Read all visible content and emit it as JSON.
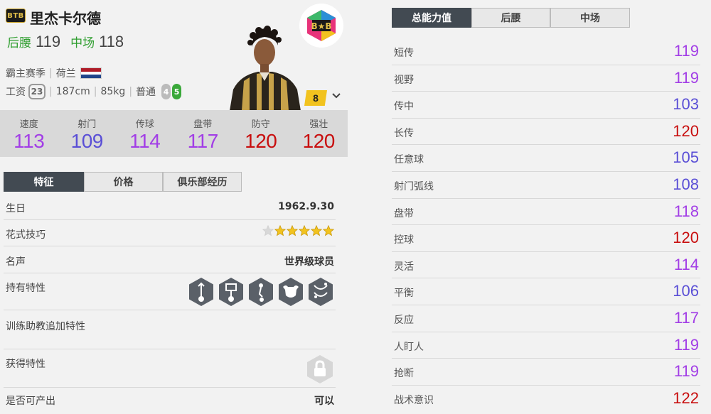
{
  "colors": {
    "purple": "#a23ee6",
    "indigo": "#5a4fd6",
    "red": "#c80e0e",
    "green": "#2f9e2f",
    "tab_active": "#424a52"
  },
  "header": {
    "season_badge": "BTB",
    "name": "里杰卡尔德",
    "positions": [
      {
        "label": "后腰",
        "value": "119"
      },
      {
        "label": "中场",
        "value": "118"
      }
    ],
    "season": "霸主赛季",
    "nation": "荷兰",
    "wage_label": "工资",
    "wage": "23",
    "height": "187cm",
    "weight": "85kg",
    "body_type": "普通",
    "weak_foot": "4",
    "strong_foot": "5",
    "club_badge": "B★B",
    "level": "8"
  },
  "summary_stats": [
    {
      "label": "速度",
      "value": "113",
      "color": "#a23ee6"
    },
    {
      "label": "射门",
      "value": "109",
      "color": "#5a4fd6"
    },
    {
      "label": "传球",
      "value": "114",
      "color": "#a23ee6"
    },
    {
      "label": "盘带",
      "value": "117",
      "color": "#a23ee6"
    },
    {
      "label": "防守",
      "value": "120",
      "color": "#c80e0e"
    },
    {
      "label": "强壮",
      "value": "120",
      "color": "#c80e0e"
    }
  ],
  "left_tabs": [
    "特征",
    "价格",
    "俱乐部经历"
  ],
  "details": {
    "birthday_label": "生日",
    "birthday": "1962.9.30",
    "skill_label": "花式技巧",
    "skill_stars": 5,
    "reputation_label": "名声",
    "reputation": "世界级球员",
    "traits_label": "持有特性",
    "traits_icons": [
      "trait-long-pass-icon",
      "trait-long-shot-icon",
      "trait-dribble-icon",
      "trait-bull-icon",
      "trait-tactics-icon"
    ],
    "coach_label": "训练助教追加特性",
    "acquired_label": "获得特性",
    "producible_label": "是否可产出",
    "producible": "可以"
  },
  "right_tabs": [
    "总能力值",
    "后腰",
    "中场"
  ],
  "detail_stats": [
    {
      "label": "短传",
      "value": "119",
      "color": "#a23ee6"
    },
    {
      "label": "视野",
      "value": "119",
      "color": "#a23ee6"
    },
    {
      "label": "传中",
      "value": "103",
      "color": "#5a4fd6"
    },
    {
      "label": "长传",
      "value": "120",
      "color": "#c80e0e"
    },
    {
      "label": "任意球",
      "value": "105",
      "color": "#5a4fd6"
    },
    {
      "label": "射门弧线",
      "value": "108",
      "color": "#5a4fd6"
    },
    {
      "label": "盘带",
      "value": "118",
      "color": "#a23ee6"
    },
    {
      "label": "控球",
      "value": "120",
      "color": "#c80e0e"
    },
    {
      "label": "灵活",
      "value": "114",
      "color": "#a23ee6"
    },
    {
      "label": "平衡",
      "value": "106",
      "color": "#5a4fd6"
    },
    {
      "label": "反应",
      "value": "117",
      "color": "#a23ee6"
    },
    {
      "label": "人盯人",
      "value": "119",
      "color": "#a23ee6"
    },
    {
      "label": "抢断",
      "value": "119",
      "color": "#a23ee6"
    },
    {
      "label": "战术意识",
      "value": "122",
      "color": "#c80e0e"
    }
  ]
}
